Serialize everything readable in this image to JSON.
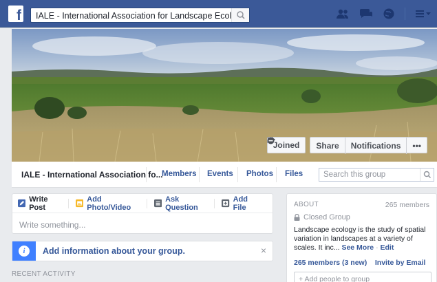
{
  "topbar": {
    "logo": "f",
    "search_value": "IALE - International Association for Landscape Ecology",
    "icons": [
      "friend-requests-icon",
      "messages-icon",
      "notifications-globe-icon",
      "account-menu-icon"
    ]
  },
  "cover": {
    "joined_label": "Joined",
    "share_label": "Share",
    "notifications_label": "Notifications",
    "more_label": "•••"
  },
  "subnav": {
    "group_name": "IALE - International Association fo...",
    "tabs": [
      "Members",
      "Events",
      "Photos",
      "Files"
    ],
    "search_placeholder": "Search this group"
  },
  "composer": {
    "tabs": [
      "Write Post",
      "Add Photo/Video",
      "Ask Question",
      "Add File"
    ],
    "placeholder": "Write something..."
  },
  "info_banner": {
    "text": "Add information about your group.",
    "close": "×"
  },
  "recent_activity": "RECENT ACTIVITY",
  "about": {
    "heading": "ABOUT",
    "member_count": "265 members",
    "privacy": "Closed Group",
    "description": "Landscape ecology is the study of spatial variation in landscapes at a variety of scales. It inc...",
    "see_more": "See More",
    "separator": "·",
    "edit": "Edit",
    "members_new": "265 members (3 new)",
    "invite": "Invite by Email",
    "add_people_placeholder": "+ Add people to group"
  },
  "colors": {
    "brand": "#3b5998",
    "link": "#365899",
    "accent_info": "#4080ff",
    "page_bg": "#e9ebee"
  }
}
